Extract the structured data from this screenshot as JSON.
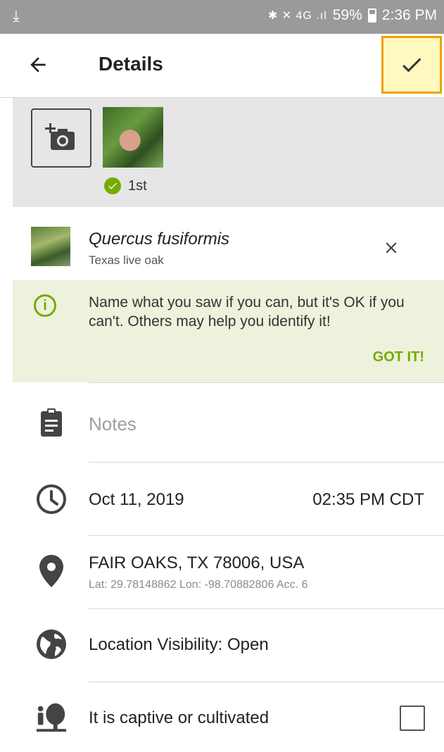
{
  "status_bar": {
    "download_icon": "download-icon",
    "signal_icons": "✱ ✕ 4G .ıl",
    "battery": "59%",
    "time": "2:36 PM"
  },
  "appbar": {
    "title": "Details",
    "back_icon": "arrow-back-icon",
    "confirm_icon": "check-icon",
    "confirm_highlight": "#fff9bf"
  },
  "photos": {
    "badge_label": "1st"
  },
  "taxon": {
    "scientific_name": "Quercus fusiformis",
    "common_name": "Texas live oak"
  },
  "tip": {
    "message": "Name what you saw if you can, but it's OK if you can't. Others may help you identify it!",
    "dismiss_label": "GOT IT!"
  },
  "notes": {
    "placeholder": "Notes"
  },
  "datetime": {
    "date": "Oct 11, 2019",
    "time": "02:35 PM CDT"
  },
  "location": {
    "place": "FAIR OAKS, TX 78006, USA",
    "coords": "Lat: 29.78148862 Lon: -98.70882806 Acc. 6"
  },
  "visibility": {
    "label": "Location Visibility: Open"
  },
  "captive": {
    "label": "It is captive or cultivated",
    "checked": false
  },
  "colors": {
    "accent_green": "#74ac00",
    "tip_background": "#eef1dc",
    "highlight_border": "#f0a000"
  }
}
